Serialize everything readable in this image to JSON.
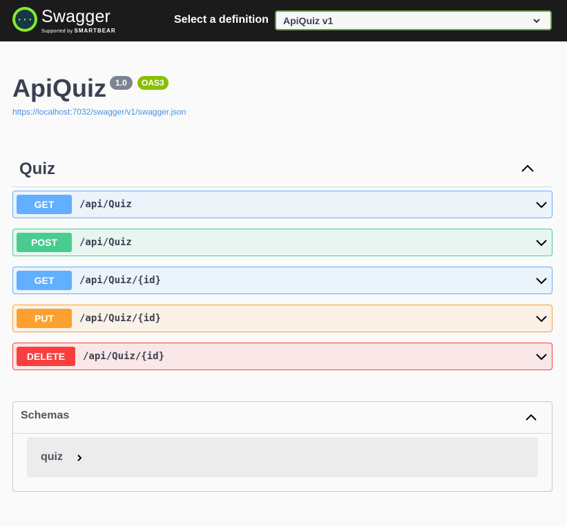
{
  "topbar": {
    "brand": "Swagger",
    "brand_sub": "Supported by",
    "brand_sub_strong": "SMARTBEAR",
    "definition_label": "Select a definition",
    "definition_selected": "ApiQuiz v1"
  },
  "info": {
    "title": "ApiQuiz",
    "version": "1.0",
    "oas": "OAS3",
    "spec_url": "https://localhost:7032/swagger/v1/swagger.json"
  },
  "tag": {
    "name": "Quiz"
  },
  "operations": [
    {
      "method": "GET",
      "path": "/api/Quiz"
    },
    {
      "method": "POST",
      "path": "/api/Quiz"
    },
    {
      "method": "GET",
      "path": "/api/Quiz/{id}"
    },
    {
      "method": "PUT",
      "path": "/api/Quiz/{id}"
    },
    {
      "method": "DELETE",
      "path": "/api/Quiz/{id}"
    }
  ],
  "schemas": {
    "title": "Schemas",
    "models": [
      {
        "name": "quiz"
      }
    ]
  },
  "colors": {
    "get": "#61affe",
    "post": "#49cc90",
    "put": "#fca130",
    "delete": "#f93e3e",
    "brand_green": "#85ea2d"
  }
}
